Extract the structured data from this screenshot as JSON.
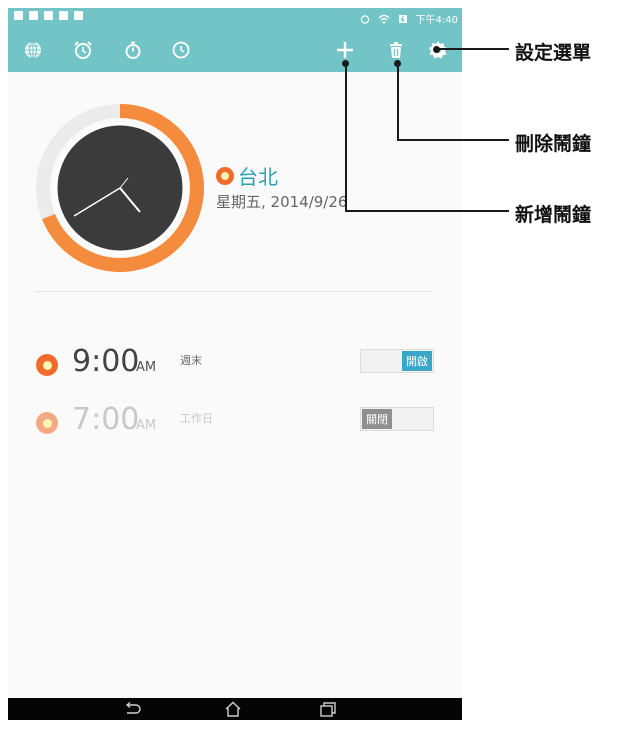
{
  "status_bar": {
    "time": "下午4:40",
    "alarm_icon": "alarm-icon",
    "wifi_icon": "wifi-icon",
    "battery_icon": "battery-charging-icon"
  },
  "toolbar": {
    "icons": [
      "world-clock-icon",
      "alarm-clock-icon",
      "stopwatch-icon",
      "timer-icon"
    ],
    "add_icon": "plus-icon",
    "delete_icon": "trash-icon",
    "settings_icon": "gear-icon",
    "accent_color": "#72c4c7"
  },
  "world_clock": {
    "city": "台北",
    "date": "星期五, 2014/9/26",
    "arc_color": "#f58b3c"
  },
  "alarms": [
    {
      "time": "9:00",
      "ampm": "AM",
      "days": "週末",
      "toggle_label": "開啟",
      "enabled": true,
      "toggle_color": "#3aa7c9"
    },
    {
      "time": "7:00",
      "ampm": "AM",
      "days": "工作日",
      "toggle_label": "關閉",
      "enabled": false,
      "toggle_color": "#8f8f8f"
    }
  ],
  "nav_bar": {
    "back_icon": "back-icon",
    "home_icon": "home-icon",
    "recents_icon": "recents-icon"
  },
  "callouts": {
    "settings": "設定選單",
    "delete": "刪除鬧鐘",
    "add": "新增鬧鐘"
  }
}
